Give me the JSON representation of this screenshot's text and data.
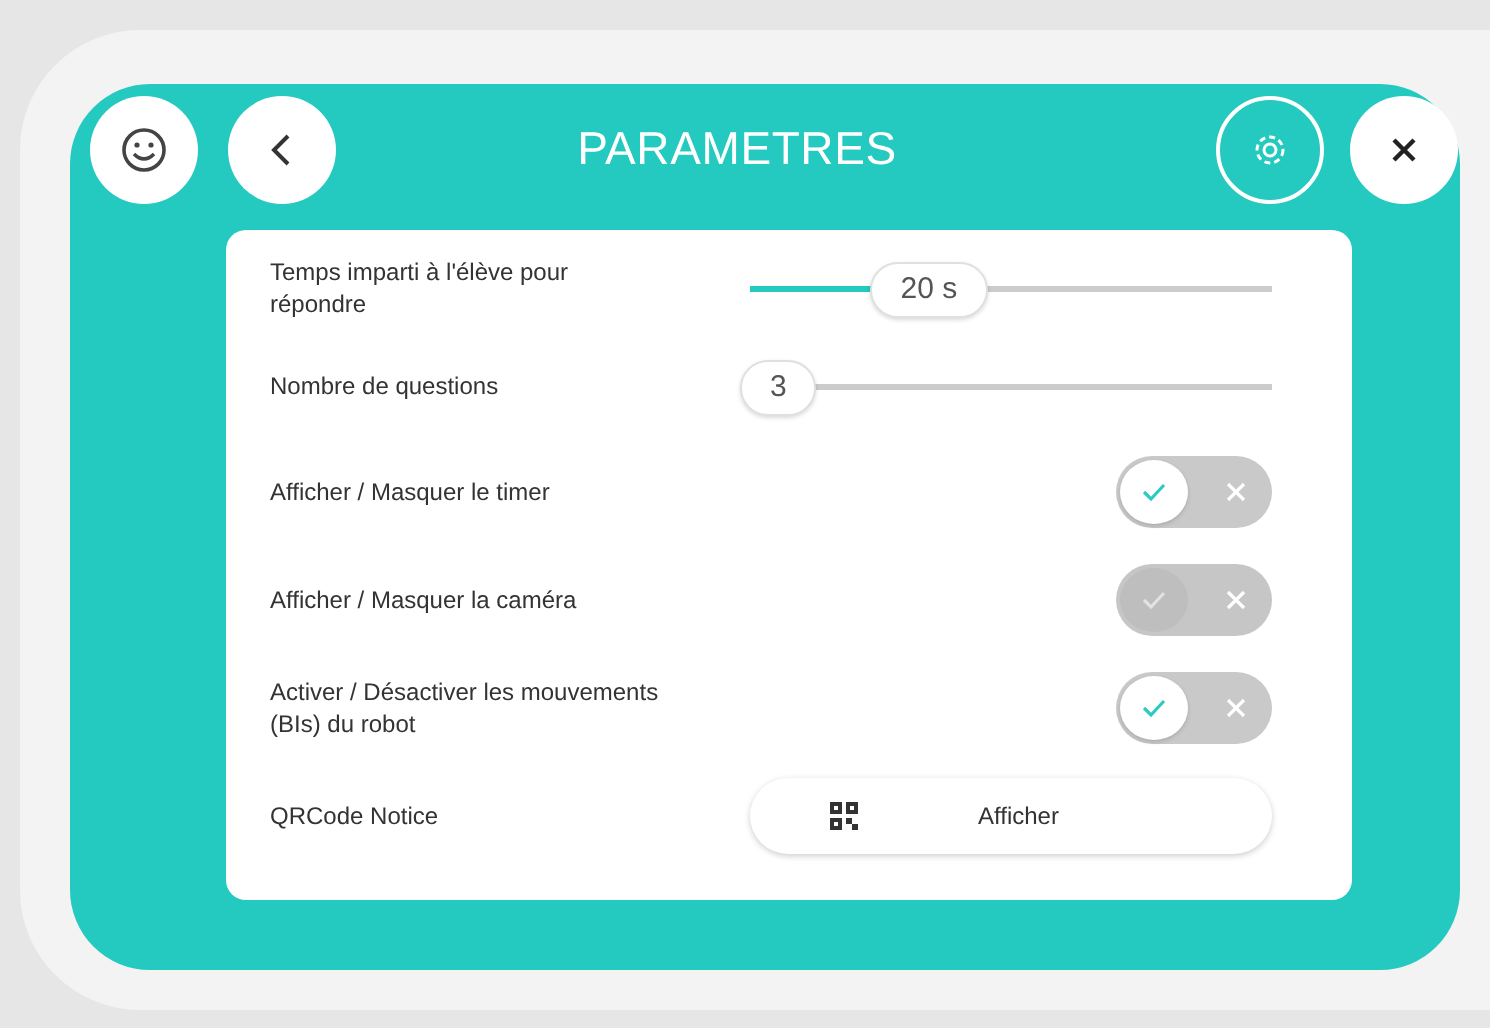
{
  "header": {
    "title": "PARAMETRES"
  },
  "settings": [
    {
      "kind": "slider",
      "label": "Temps imparti à l'élève pour répondre",
      "reading": "20 s",
      "level": 0.25
    },
    {
      "kind": "slider",
      "label": "Nombre de questions",
      "reading": "3",
      "level": 0
    },
    {
      "kind": "toggle",
      "label": "Afficher / Masquer le timer",
      "on": true,
      "disabled": false
    },
    {
      "kind": "toggle",
      "label": "Afficher / Masquer la caméra",
      "on": true,
      "disabled": true
    },
    {
      "kind": "toggle",
      "label": "Activer / Désactiver les mouvements (BIs) du robot",
      "on": true,
      "disabled": false
    },
    {
      "kind": "button",
      "label": "QRCode Notice",
      "button": "Afficher"
    }
  ]
}
